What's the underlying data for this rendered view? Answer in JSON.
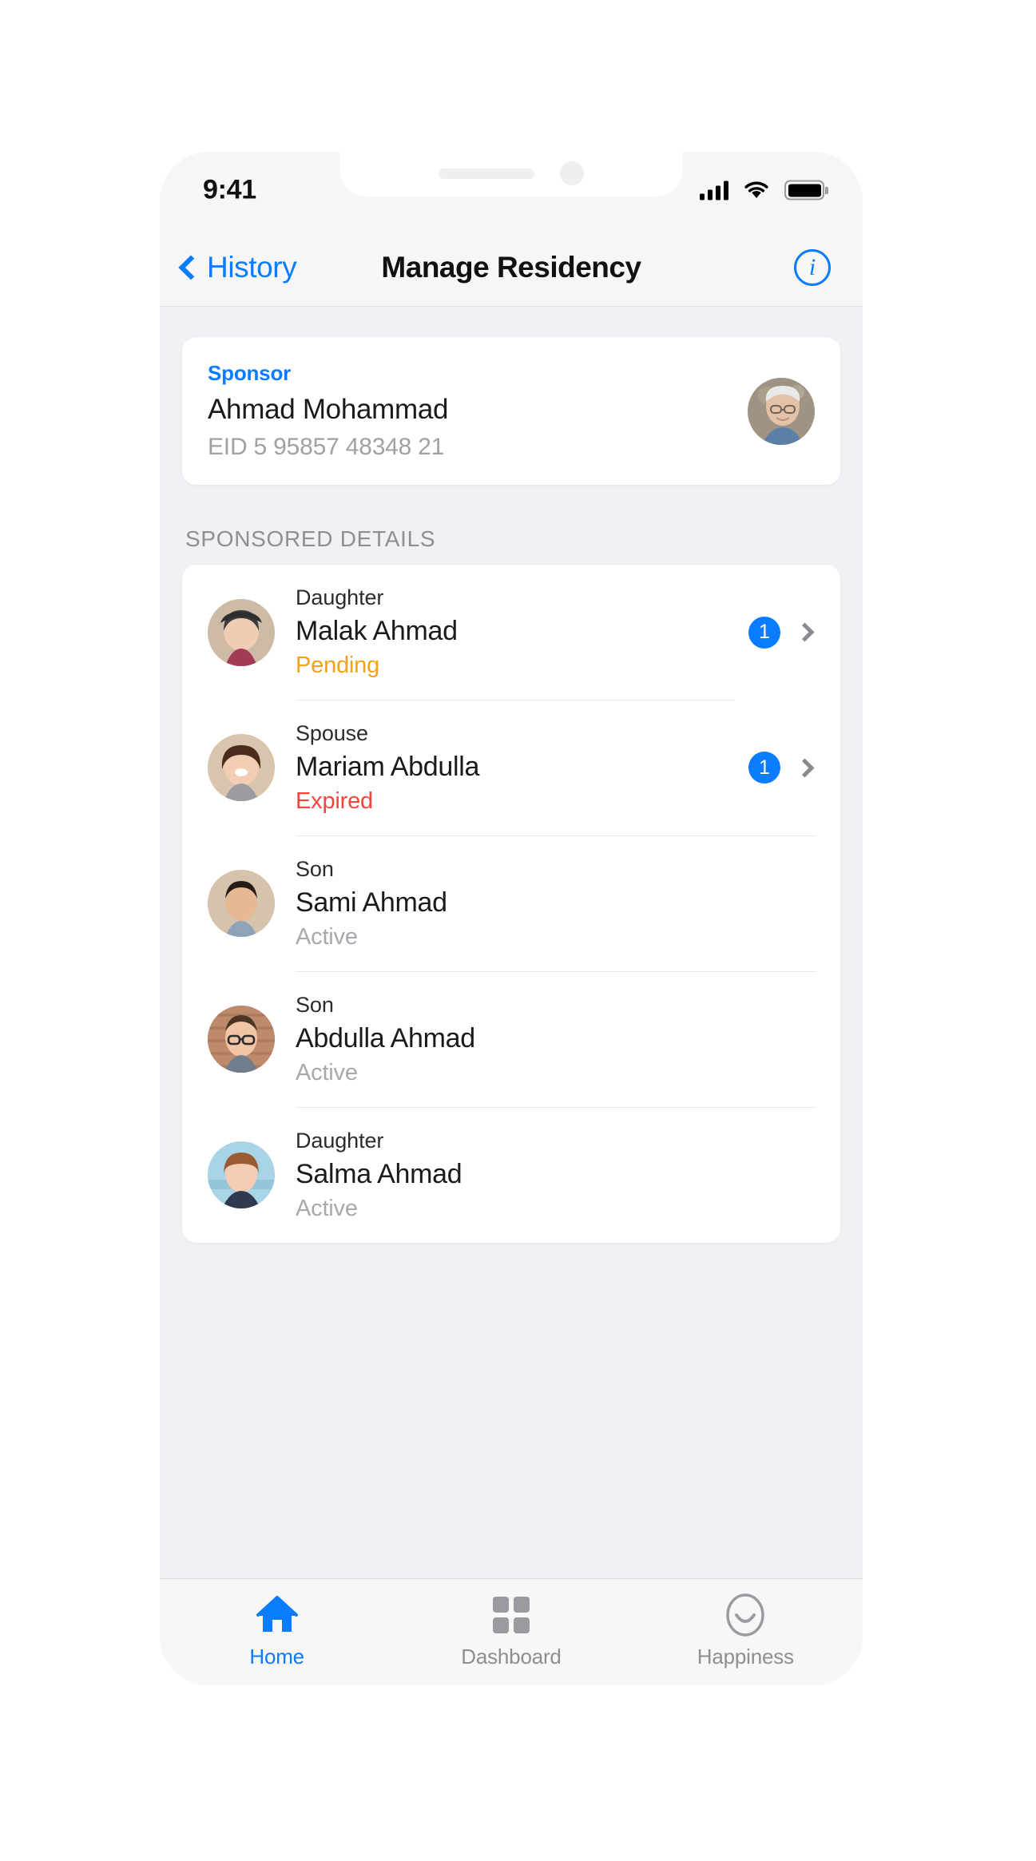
{
  "status_bar": {
    "time": "9:41",
    "cellular_icon": "signal-bars-icon",
    "wifi_icon": "wifi-icon",
    "battery_icon": "battery-full-icon"
  },
  "nav": {
    "back_label": "History",
    "back_icon": "chevron-left-icon",
    "title": "Manage Residency",
    "info_icon": "info-circle-icon",
    "info_glyph": "i"
  },
  "sponsor": {
    "label": "Sponsor",
    "name": "Ahmad Mohammad",
    "eid": "EID 5 95857 48348 21",
    "avatar_icon": "sponsor-avatar"
  },
  "section": {
    "header": "SPONSORED DETAILS"
  },
  "sponsored": [
    {
      "relation": "Daughter",
      "name": "Malak Ahmad",
      "status": "Pending",
      "status_kind": "pending",
      "badge": "1",
      "has_chevron": true
    },
    {
      "relation": "Spouse",
      "name": "Mariam Abdulla",
      "status": "Expired",
      "status_kind": "expired",
      "badge": "1",
      "has_chevron": true
    },
    {
      "relation": "Son",
      "name": "Sami Ahmad",
      "status": "Active",
      "status_kind": "active",
      "badge": "",
      "has_chevron": false
    },
    {
      "relation": "Son",
      "name": "Abdulla Ahmad",
      "status": "Active",
      "status_kind": "active",
      "badge": "",
      "has_chevron": false
    },
    {
      "relation": "Daughter",
      "name": "Salma Ahmad",
      "status": "Active",
      "status_kind": "active",
      "badge": "",
      "has_chevron": false
    }
  ],
  "tabs": [
    {
      "label": "Home",
      "icon": "home-icon",
      "active": true
    },
    {
      "label": "Dashboard",
      "icon": "grid-icon",
      "active": false
    },
    {
      "label": "Happiness",
      "icon": "smiley-icon",
      "active": false
    }
  ],
  "colors": {
    "accent_blue": "#0A7CFF",
    "pending_orange": "#F5A118",
    "expired_red": "#F4453C",
    "active_gray": "#A8A8AE",
    "screen_bg": "#F1F0F5",
    "card_bg": "#FFFFFF"
  }
}
